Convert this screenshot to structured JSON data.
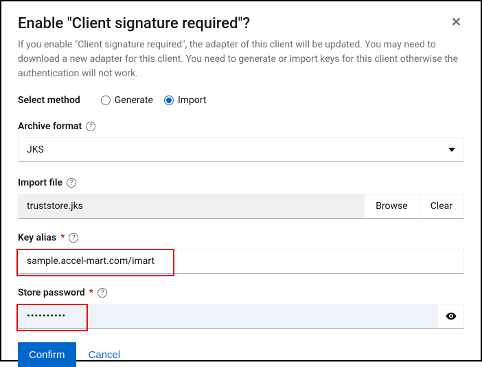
{
  "dialog": {
    "title": "Enable \"Client signature required\"?",
    "description": "If you enable \"Client signature required\", the adapter of this client will be updated. You may need to download a new adapter for this client. You need to generate or import keys for this client otherwise the authentication will not work."
  },
  "method": {
    "label": "Select method",
    "options": {
      "generate": "Generate",
      "import": "Import"
    },
    "selected": "import"
  },
  "archive_format": {
    "label": "Archive format",
    "value": "JKS"
  },
  "import_file": {
    "label": "Import file",
    "value": "truststore.jks",
    "browse": "Browse",
    "clear": "Clear"
  },
  "key_alias": {
    "label": "Key alias",
    "value": "sample.accel-mart.com/imart"
  },
  "store_password": {
    "label": "Store password",
    "value": "••••••••••"
  },
  "footer": {
    "confirm": "Confirm",
    "cancel": "Cancel"
  }
}
